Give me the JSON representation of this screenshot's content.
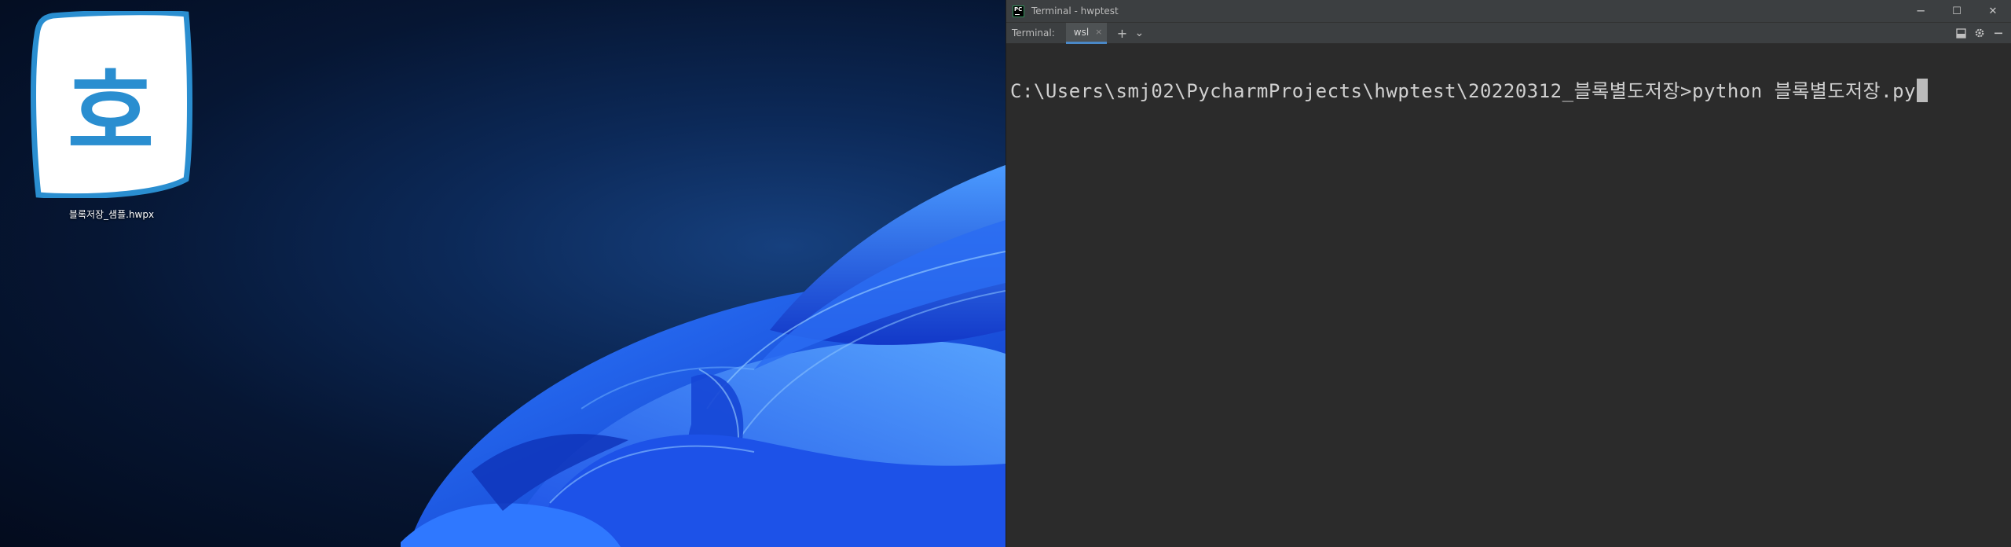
{
  "desktop": {
    "icon": {
      "glyph": "호",
      "label": "블록저장_샘플.hwpx",
      "icon_name": "hwp-document-icon",
      "accent": "#2a8ed0"
    }
  },
  "window": {
    "title": "Terminal - hwptest",
    "logo_text": "PC",
    "controls": {
      "minimize": "─",
      "maximize": "☐",
      "close": "✕"
    }
  },
  "toolwindow": {
    "title": "Terminal:",
    "tabs": [
      {
        "label": "wsl",
        "close": "×"
      }
    ],
    "add_tab": "+",
    "more_tabs": "⌄"
  },
  "terminal": {
    "prompt": "C:\\Users\\smj02\\PycharmProjects\\hwptest\\20220312_블록별도저장>",
    "command": "python 블록별도저장.py"
  },
  "colors": {
    "window_bg": "#2b2b2b",
    "titlebar_bg": "#3c3f41",
    "tab_underline": "#4a88c7",
    "terminal_text": "#d0d0d0"
  }
}
